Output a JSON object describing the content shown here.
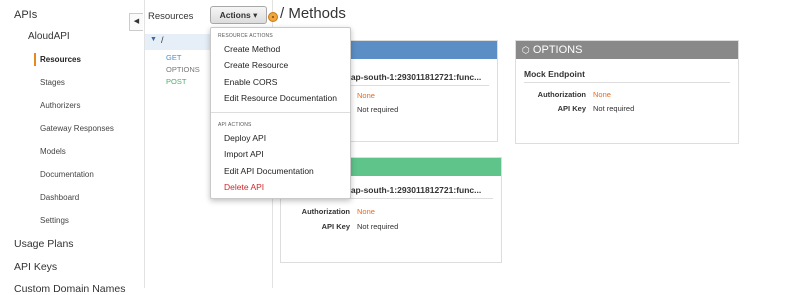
{
  "nav": {
    "apis": "APIs",
    "api_name": "AloudAPI",
    "items": [
      "Resources",
      "Stages",
      "Authorizers",
      "Gateway Responses",
      "Models",
      "Documentation",
      "Dashboard",
      "Settings"
    ],
    "usage_plans": "Usage Plans",
    "api_keys": "API Keys",
    "custom_domain": "Custom Domain Names"
  },
  "tree": {
    "header": "Resources",
    "root": "/",
    "methods": [
      {
        "label": "GET",
        "color": "#4a8fd1"
      },
      {
        "label": "OPTIONS",
        "color": "#777777"
      },
      {
        "label": "POST",
        "color": "#4cae6d"
      }
    ]
  },
  "toolbar": {
    "actions_label": "Actions ▾",
    "title": "/ Methods"
  },
  "cards": {
    "get": {
      "header_color": "#5b8ec5",
      "endpoint": ":ap-south-1:293011812721:func...",
      "authorization_value": "None",
      "api_key_value": "Not required"
    },
    "options": {
      "header_color": "#898989",
      "title": "OPTIONS",
      "endpoint": "Mock Endpoint",
      "authorization_label": "Authorization",
      "authorization_value": "None",
      "api_key_label": "API Key",
      "api_key_value": "Not required"
    },
    "post": {
      "header_color": "#5ec48a",
      "endpoint": ":ap-south-1:293011812721:func...",
      "authorization_label": "Authorization",
      "authorization_value": "None",
      "api_key_label": "API Key",
      "api_key_value": "Not required"
    }
  },
  "menu": {
    "resource_section": "RESOURCE ACTIONS",
    "resource_items": [
      "Create Method",
      "Create Resource",
      "Enable CORS",
      "Edit Resource Documentation"
    ],
    "api_section": "API ACTIONS",
    "api_items": [
      "Deploy API",
      "Import API",
      "Edit API Documentation",
      "Delete API"
    ]
  }
}
